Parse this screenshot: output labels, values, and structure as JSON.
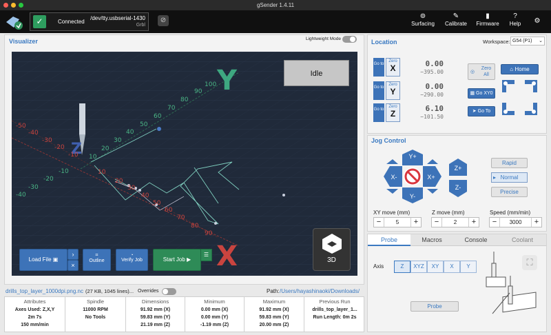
{
  "app": {
    "title": "gSender 1.4.11"
  },
  "connection": {
    "status": "Connected",
    "port": "/dev/tty.usbserial-1430",
    "firmware": "Grbl"
  },
  "nav": [
    {
      "label": "Surfacing",
      "icon": "surfacing-icon"
    },
    {
      "label": "Calibrate",
      "icon": "calibrate-icon"
    },
    {
      "label": "Firmware",
      "icon": "firmware-icon"
    },
    {
      "label": "Help",
      "icon": "help-icon"
    }
  ],
  "visualizer": {
    "title": "Visualizer",
    "lightweight_label": "Lightweight Mode",
    "state": "Idle",
    "view_label": "3D",
    "axis_x": "X",
    "axis_y": "Y",
    "axis_z": "Z"
  },
  "job_buttons": {
    "load": "Load File",
    "outline": "Outline",
    "verify": "Verify Job",
    "start": "Start Job"
  },
  "file": {
    "name": "drills_top_layer_1000dpi.png.nc",
    "meta": "(27 KB, 1045 lines)...",
    "overrides": "Overrides",
    "path_label": "Path:",
    "path": "/Users/hayashinaoki/Downloads/"
  },
  "stats": {
    "attributes": {
      "h": "Attributes",
      "l1": "Axes Used: Z,X,Y",
      "l2": "2m 7s",
      "l3": "150 mm/min"
    },
    "spindle": {
      "h": "Spindle",
      "l1": "11000 RPM",
      "l2": "No Tools"
    },
    "dimensions": {
      "h": "Dimensions",
      "l1": "91.92 mm (X)",
      "l2": "59.83 mm (Y)",
      "l3": "21.19 mm (Z)"
    },
    "minimum": {
      "h": "Minimum",
      "l1": "0.00 mm (X)",
      "l2": "0.00 mm (Y)",
      "l3": "-1.19 mm (Z)"
    },
    "maximum": {
      "h": "Maximum",
      "l1": "91.92 mm (X)",
      "l2": "59.83 mm (Y)",
      "l3": "20.00 mm (Z)"
    },
    "previous": {
      "h": "Previous Run",
      "l1": "drills_top_layer_1...",
      "l2": "Run Length: 0m 2s"
    }
  },
  "location": {
    "title": "Location",
    "workspace_label": "Workspace:",
    "workspace": "G54 (P1)",
    "goto": "Go to",
    "zero": "Zero",
    "axes": [
      {
        "name": "X",
        "value": "0.00",
        "machine": "−395.00"
      },
      {
        "name": "Y",
        "value": "0.00",
        "machine": "−290.00"
      },
      {
        "name": "Z",
        "value": "6.10",
        "machine": "−101.50"
      }
    ],
    "zero_all": "Zero All",
    "home": "Home",
    "go_xy0": "Go XY0",
    "go_to": "Go To"
  },
  "jog": {
    "title": "Jog Control",
    "ypos": "Y+",
    "yneg": "Y-",
    "xpos": "X+",
    "xneg": "X-",
    "zpos": "Z+",
    "zneg": "Z-",
    "rapid": "Rapid",
    "normal": "Normal",
    "precise": "Precise",
    "xy_label": "XY move (mm)",
    "xy_value": "5",
    "z_label": "Z move (mm)",
    "z_value": "2",
    "speed_label": "Speed (mm/min)",
    "speed_value": "3000"
  },
  "tabs": [
    "Probe",
    "Macros",
    "Console",
    "Coolant"
  ],
  "probe": {
    "axis_label": "Axis",
    "axes": [
      "Z",
      "XYZ",
      "XY",
      "X",
      "Y"
    ],
    "button": "Probe"
  },
  "chart_ticks": {
    "y": [
      "10",
      "20",
      "30",
      "40",
      "50",
      "60",
      "70",
      "80",
      "90",
      "100"
    ],
    "x": [
      "10",
      "20",
      "30",
      "40",
      "50",
      "60",
      "70",
      "80",
      "90"
    ],
    "neg": [
      "-50",
      "-40",
      "-30",
      "-20",
      "-10"
    ]
  }
}
